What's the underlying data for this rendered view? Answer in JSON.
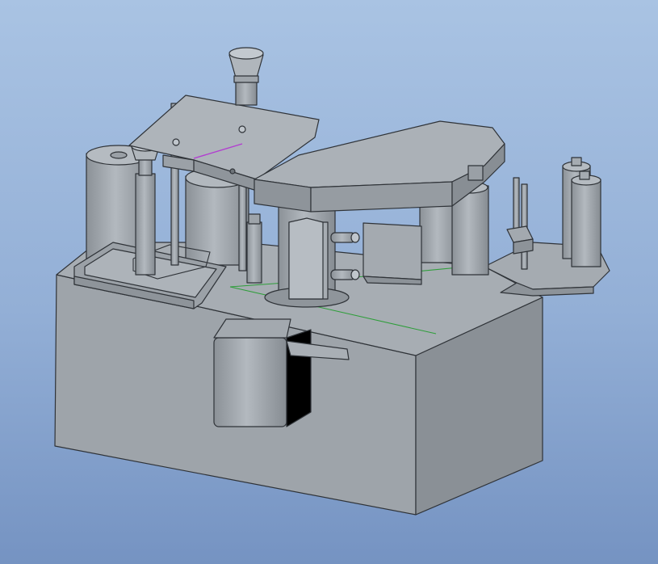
{
  "viewport": {
    "background_top": "#a9c3e3",
    "background_bottom": "#7593c2"
  },
  "model": {
    "face_light": "#a9afb5",
    "face_mid": "#9aa0a6",
    "face_dark": "#868c92",
    "edge_color": "#2f3338",
    "datum_line_color": "#2e9e3a",
    "highlight_edge_color": "#b23bd1"
  }
}
